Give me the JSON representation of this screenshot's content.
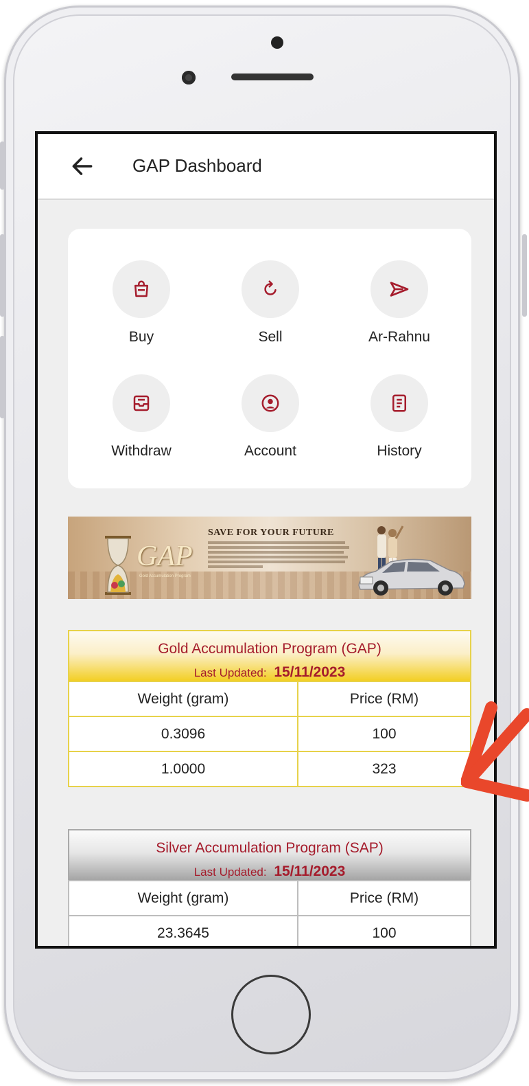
{
  "header": {
    "title": "GAP Dashboard"
  },
  "menu": {
    "items": [
      {
        "label": "Buy",
        "icon": "shopping-bag-icon"
      },
      {
        "label": "Sell",
        "icon": "refresh-icon"
      },
      {
        "label": "Ar-Rahnu",
        "icon": "send-icon"
      },
      {
        "label": "Withdraw",
        "icon": "inbox-icon"
      },
      {
        "label": "Account",
        "icon": "user-circle-icon"
      },
      {
        "label": "History",
        "icon": "document-icon"
      }
    ]
  },
  "banner": {
    "headline": "SAVE FOR YOUR FUTURE",
    "logo": "GAP",
    "logo_sub": "Gold Accumulation Program"
  },
  "gold_table": {
    "title": "Gold Accumulation Program (GAP)",
    "updated_label": "Last Updated:",
    "updated_date": "15/11/2023",
    "columns": [
      "Weight (gram)",
      "Price (RM)"
    ],
    "rows": [
      [
        "0.3096",
        "100"
      ],
      [
        "1.0000",
        "323"
      ]
    ]
  },
  "silver_table": {
    "title": "Silver Accumulation Program (SAP)",
    "updated_label": "Last Updated:",
    "updated_date": "15/11/2023",
    "columns": [
      "Weight (gram)",
      "Price (RM)"
    ],
    "rows": [
      [
        "23.3645",
        "100"
      ]
    ]
  },
  "colors": {
    "accent": "#a51c2c",
    "gold_border": "#e7d24a",
    "arrow": "#e9472b"
  }
}
